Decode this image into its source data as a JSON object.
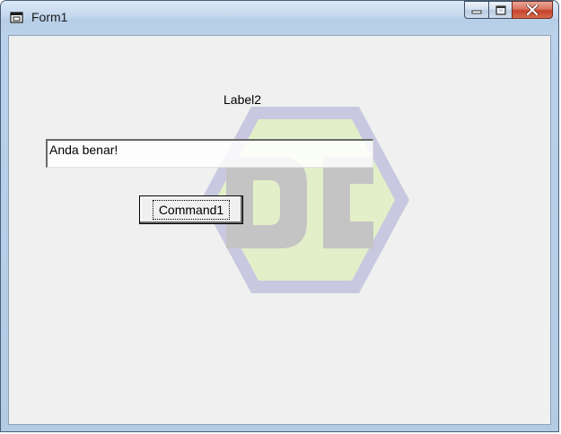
{
  "window": {
    "title": "Form1"
  },
  "caption_buttons": {
    "minimize_icon": "minimize-icon",
    "maximize_icon": "maximize-icon",
    "close_icon": "close-icon"
  },
  "form": {
    "label": "Label2",
    "textbox_value": "Anda benar!",
    "command_label": "Command1"
  },
  "colors": {
    "client_bg": "#f0f0f0",
    "close_button": "#c6422b",
    "watermark_border": "#c8c8e0",
    "watermark_fill": "#e2efc8",
    "watermark_letters": "#c4c4c4"
  }
}
